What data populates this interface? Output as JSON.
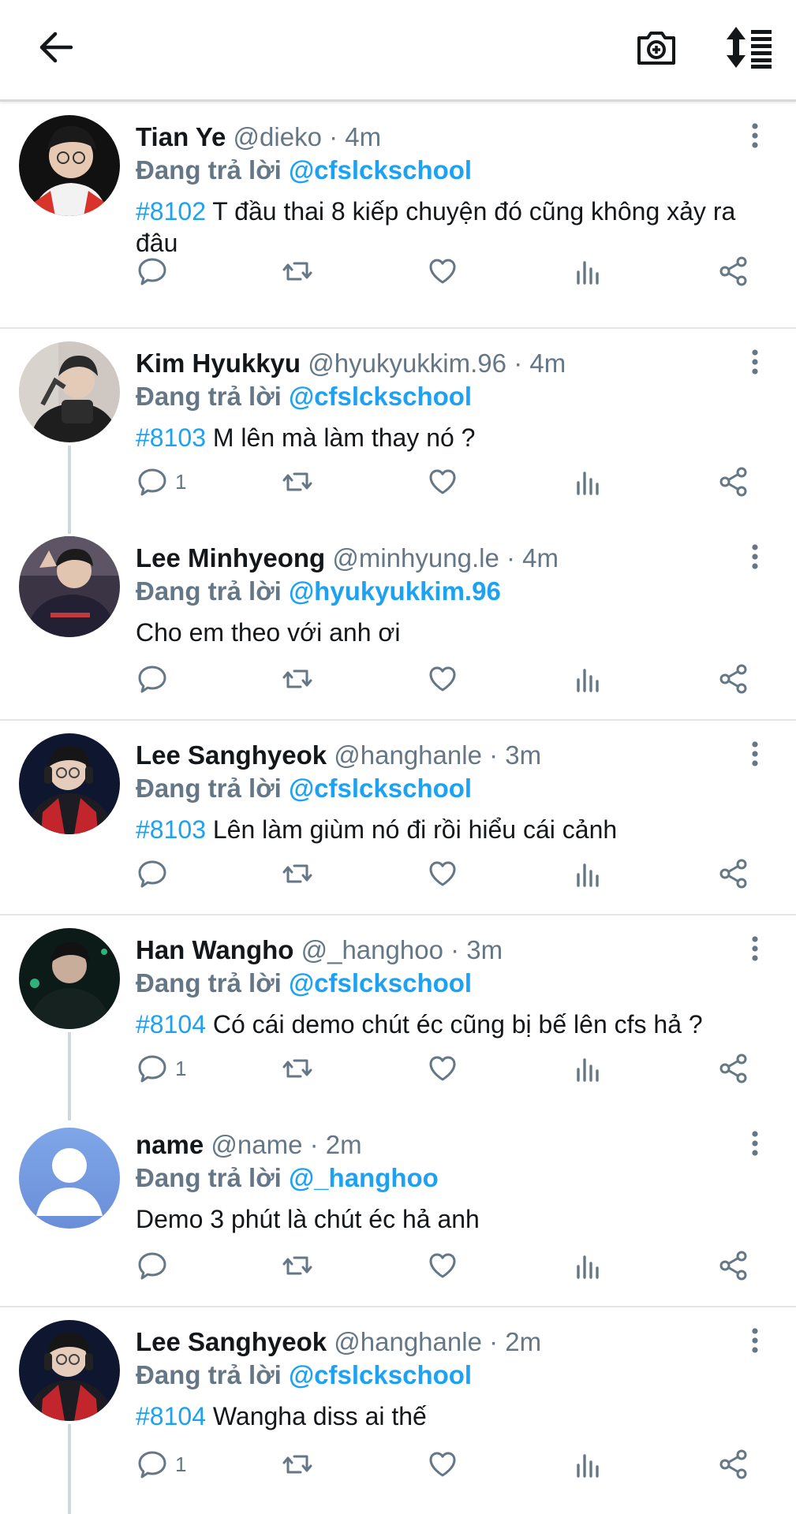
{
  "header": {
    "back_icon": "arrow-left-icon",
    "camera_icon": "camera-plus-icon",
    "sort_icon": "sort-list-icon"
  },
  "colors": {
    "link": "#1da1f2",
    "muted": "#657786",
    "divider": "#e3e6e8"
  },
  "tweets": [
    {
      "name": "Tian Ye",
      "handle": "@dieko",
      "sep": "·",
      "time": "4m",
      "reply_prefix": "Đang trả lời",
      "reply_to": "@cfslckschool",
      "tag": "#8102",
      "text": "T đầu thai 8 kiếp chuyện đó cũng không xảy ra đâu",
      "reply_count": ""
    },
    {
      "name": "Kim Hyukkyu",
      "handle": "@hyukyukkim.96",
      "sep": "·",
      "time": "4m",
      "reply_prefix": "Đang trả lời",
      "reply_to": "@cfslckschool",
      "tag": "#8103",
      "text": "M lên mà làm thay nó ?",
      "reply_count": "1"
    },
    {
      "name": "Lee Minhyeong",
      "handle": "@minhyung.le",
      "sep": "·",
      "time": "4m",
      "reply_prefix": "Đang trả lời",
      "reply_to": "@hyukyukkim.96",
      "tag": "",
      "text": "Cho em theo với anh ơi",
      "reply_count": ""
    },
    {
      "name": "Lee Sanghyeok",
      "handle": "@hanghanle",
      "sep": "·",
      "time": "3m",
      "reply_prefix": "Đang trả lời",
      "reply_to": "@cfslckschool",
      "tag": "#8103",
      "text": "Lên làm giùm nó đi rồi hiểu cái cảnh",
      "reply_count": ""
    },
    {
      "name": "Han Wangho",
      "handle": "@_hanghoo",
      "sep": "·",
      "time": "3m",
      "reply_prefix": "Đang trả lời",
      "reply_to": "@cfslckschool",
      "tag": "#8104",
      "text": "Có cái demo chút éc cũng bị bế lên cfs hả ?",
      "reply_count": "1"
    },
    {
      "name": "name",
      "handle": "@name",
      "sep": "·",
      "time": "2m",
      "reply_prefix": "Đang trả lời",
      "reply_to": "@_hanghoo",
      "tag": "",
      "text": "Demo 3 phút là chút éc hả anh",
      "reply_count": ""
    },
    {
      "name": "Lee Sanghyeok",
      "handle": "@hanghanle",
      "sep": "·",
      "time": "2m",
      "reply_prefix": "Đang trả lời",
      "reply_to": "@cfslckschool",
      "tag": "#8104",
      "text": "Wangha diss ai thế",
      "reply_count": "1"
    }
  ]
}
